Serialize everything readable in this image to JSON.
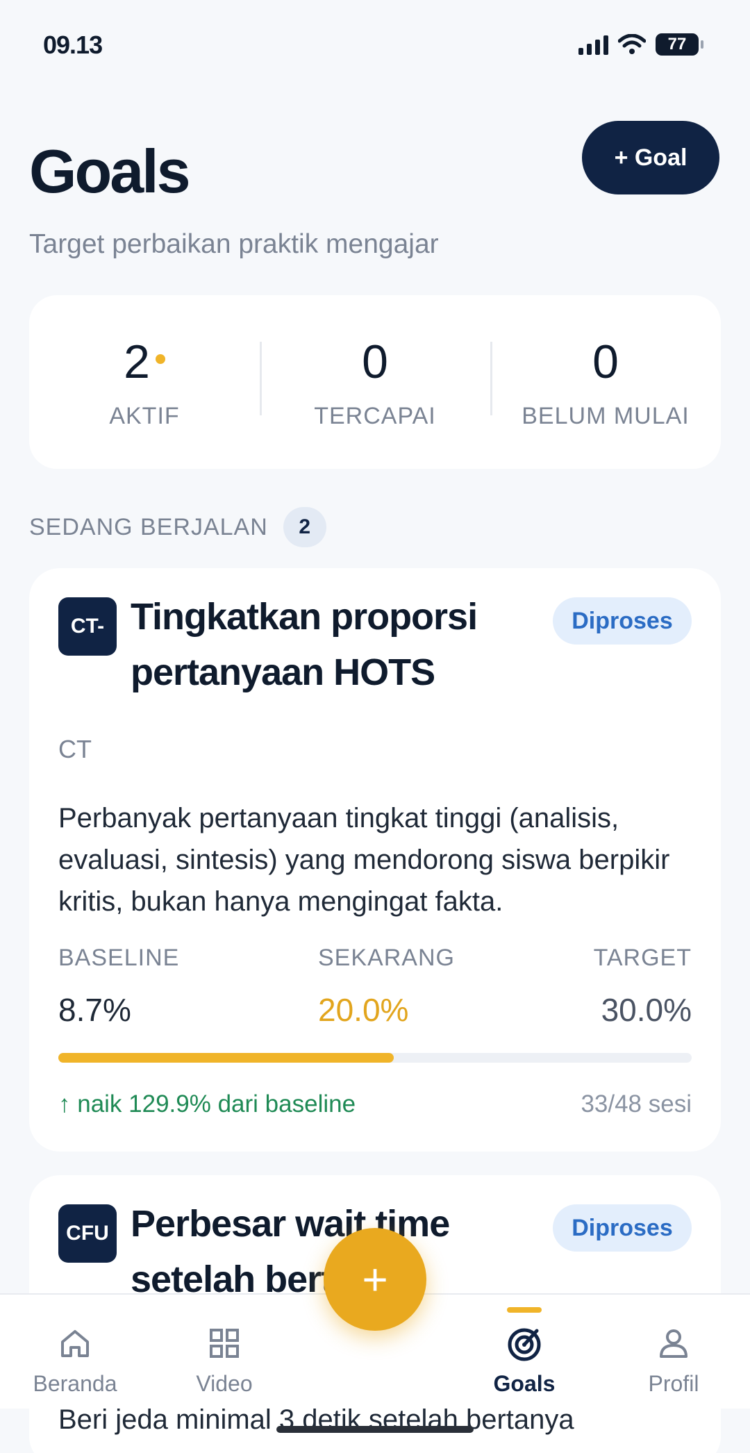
{
  "status_bar": {
    "time": "09.13",
    "battery": "77"
  },
  "header": {
    "title": "Goals",
    "add_button": "+ Goal",
    "subtitle": "Target perbaikan praktik mengajar"
  },
  "stats": [
    {
      "value": "2",
      "label": "AKTIF"
    },
    {
      "value": "0",
      "label": "TERCAPAI"
    },
    {
      "value": "0",
      "label": "BELUM MULAI"
    }
  ],
  "section": {
    "label": "SEDANG BERJALAN",
    "count": "2"
  },
  "goals": [
    {
      "code": "CT-",
      "title": "Tingkatkan proporsi pertanyaan HOTS",
      "status": "Diproses",
      "category": "CT",
      "description": "Perbanyak pertanyaan tingkat tinggi (analisis, evaluasi, sintesis) yang mendorong siswa berpikir kritis, bukan hanya mengingat fakta.",
      "baseline_label": "BASELINE",
      "baseline": "8.7%",
      "current_label": "SEKARANG",
      "current": "20.0%",
      "target_label": "TARGET",
      "target": "30.0%",
      "progress": 0.53,
      "change": "↑ naik 129.9% dari baseline",
      "sessions": "33/48 sesi"
    },
    {
      "code": "CFU",
      "title": "Perbesar wait time setelah bertanya",
      "status": "Diproses",
      "description": "Beri jeda minimal 3 detik setelah bertanya"
    }
  ],
  "nav": {
    "items": [
      {
        "label": "Beranda",
        "icon": "home-icon"
      },
      {
        "label": "Video",
        "icon": "grid-icon"
      },
      {
        "label": "Goals",
        "icon": "target-icon",
        "active": true
      },
      {
        "label": "Profil",
        "icon": "user-icon"
      }
    ],
    "fab": "+"
  },
  "colors": {
    "navy": "#102344",
    "accent": "#f0b429",
    "positive": "#1f8a55",
    "pill": "#2b6cc4"
  }
}
